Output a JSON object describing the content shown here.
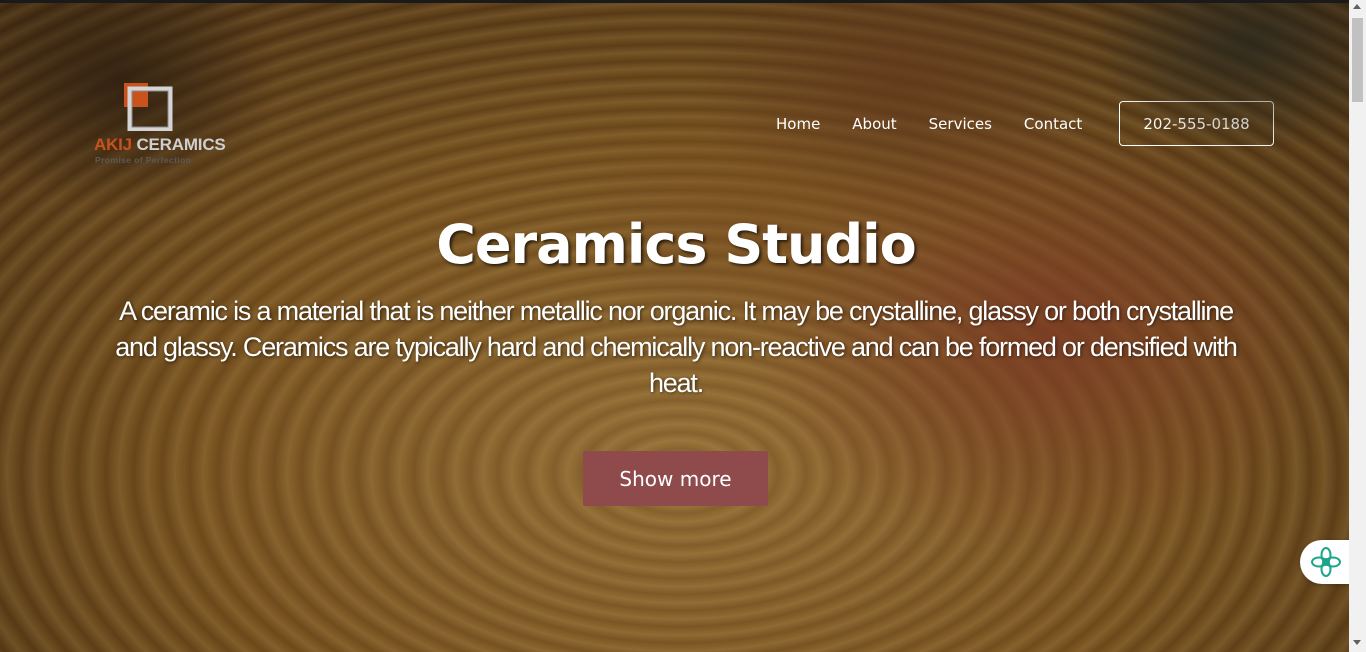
{
  "logo": {
    "brand_primary": "AKIJ",
    "brand_secondary": "CERAMICS",
    "tagline": "Promise of Perfection",
    "accent_color": "#c9521e"
  },
  "nav": {
    "items": [
      {
        "label": "Home"
      },
      {
        "label": "About"
      },
      {
        "label": "Services"
      },
      {
        "label": "Contact"
      }
    ],
    "phone": "202-555-0188"
  },
  "hero": {
    "title": "Ceramics Studio",
    "description": "A ceramic is a material that is neither metallic nor organic. It may be crystalline, glassy or both crystalline and glassy. Ceramics are typically hard and chemically non-reactive and can be formed or densified with heat.",
    "cta_label": "Show more",
    "cta_color": "#8f4a4c"
  },
  "widget": {
    "icon": "assistant-flower-icon",
    "color": "#1aa68a"
  }
}
